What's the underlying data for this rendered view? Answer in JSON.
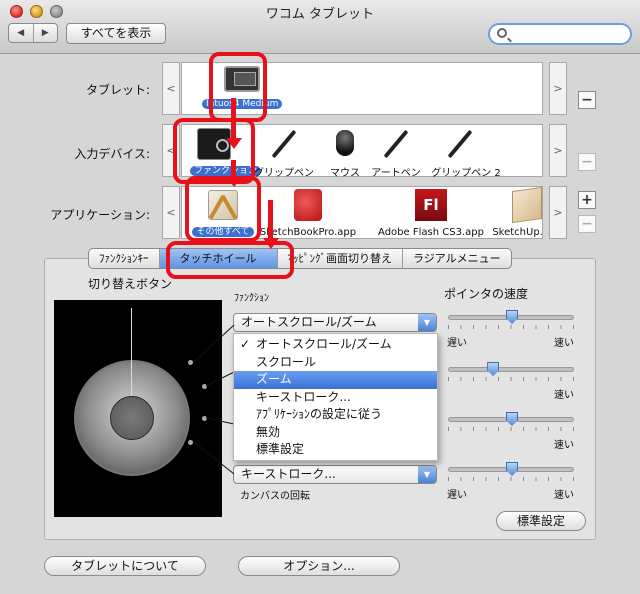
{
  "window": {
    "title": "ワコム タブレット"
  },
  "toolbar": {
    "back": "◀",
    "forward": "▶",
    "show_all": "すべてを表示",
    "search_placeholder": ""
  },
  "rows": {
    "tablet": {
      "label": "タブレット:",
      "items": [
        {
          "label": "Intuos4 Medium",
          "selected": true
        }
      ]
    },
    "input_device": {
      "label": "入力デバイス:",
      "items": [
        {
          "label": "ファンクション",
          "selected": true
        },
        {
          "label": "グリップペン"
        },
        {
          "label": "マウス"
        },
        {
          "label": "アートペン"
        },
        {
          "label": "グリップペン 2"
        }
      ]
    },
    "application": {
      "label": "アプリケーション:",
      "items": [
        {
          "label": "その他すべて",
          "selected": true
        },
        {
          "label": "SketchBookPro.app"
        },
        {
          "label": "Adobe Flash CS3.app"
        },
        {
          "label": "SketchUp.app"
        }
      ]
    },
    "scroll_left": "<",
    "scroll_right": ">",
    "minus": "−",
    "plus": "+"
  },
  "tabs": [
    {
      "label": "ﾌｧﾝｸｼｮﾝｷｰ"
    },
    {
      "label": "タッチホイール",
      "active": true
    },
    {
      "label": "ﾏｯﾋﾟﾝｸﾞ画面切り替え"
    },
    {
      "label": "ラジアルメニュー"
    }
  ],
  "touch_wheel": {
    "toggle_button_label": "切り替えボタン",
    "function_label": "ﾌｧﾝｸｼｮﾝ",
    "pointer_speed_label": "ポインタの速度",
    "popup1_value": "オートスクロール/ズーム",
    "popup4_value": "キーストローク...",
    "canvas_rotation_label": "カンバスの回転",
    "slow": "遅い",
    "fast": "速い",
    "dropdown_options": [
      {
        "label": "オートスクロール/ズーム",
        "checked": true
      },
      {
        "label": "スクロール"
      },
      {
        "label": "ズーム",
        "highlighted": true
      },
      {
        "label": "キーストローク..."
      },
      {
        "label": "ｱﾌﾟﾘｹｰｼｮﾝの設定に従う"
      },
      {
        "label": "無効"
      },
      {
        "label": "標準設定"
      }
    ],
    "speed_levels": [
      0.5,
      0.35,
      0.5,
      0.5
    ],
    "default_button": "標準設定"
  },
  "footer": {
    "about_button": "タブレットについて",
    "options_button": "オプション..."
  },
  "annotation_color": "#e8101a",
  "selection_color": "#3b6fd0"
}
